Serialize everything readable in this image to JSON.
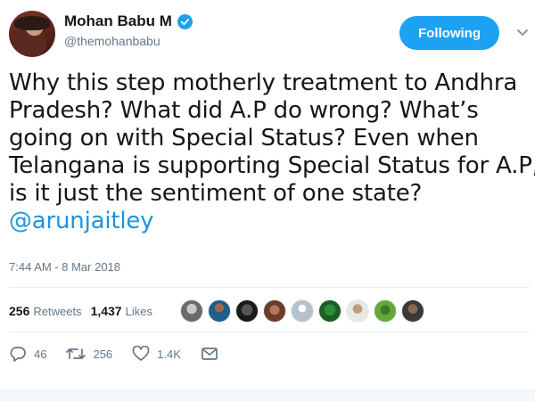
{
  "author": {
    "display_name": "Mohan Babu M",
    "handle": "@themohanbabu",
    "verified": true
  },
  "follow_button": {
    "label": "Following"
  },
  "tweet": {
    "lines": [
      "Why this step motherly treatment to Andhra",
      "Pradesh? What did A.P do wrong? What’s",
      "going on with Special Status? Even when",
      "Telangana is supporting Special Status for A.P,",
      "is it just the sentiment of one state?"
    ],
    "mention": "@arunjaitley",
    "timestamp": "7:44 AM - 8 Mar 2018"
  },
  "stats": {
    "retweets_count": "256",
    "retweets_label": "Retweets",
    "likes_count": "1,437",
    "likes_label": "Likes"
  },
  "likers": [
    "avatar",
    "avatar",
    "avatar",
    "avatar",
    "avatar",
    "avatar",
    "avatar",
    "avatar",
    "avatar"
  ],
  "actions": {
    "reply_count": "46",
    "retweet_count": "256",
    "like_count": "1.4K"
  },
  "colors": {
    "accent": "#1da1f2",
    "mention": "#1b95e0",
    "muted": "#657786"
  },
  "icons": {
    "verified": "verified-badge-icon",
    "caret": "chevron-down-icon",
    "reply": "reply-icon",
    "retweet": "retweet-icon",
    "like": "heart-icon",
    "dm": "envelope-icon"
  }
}
